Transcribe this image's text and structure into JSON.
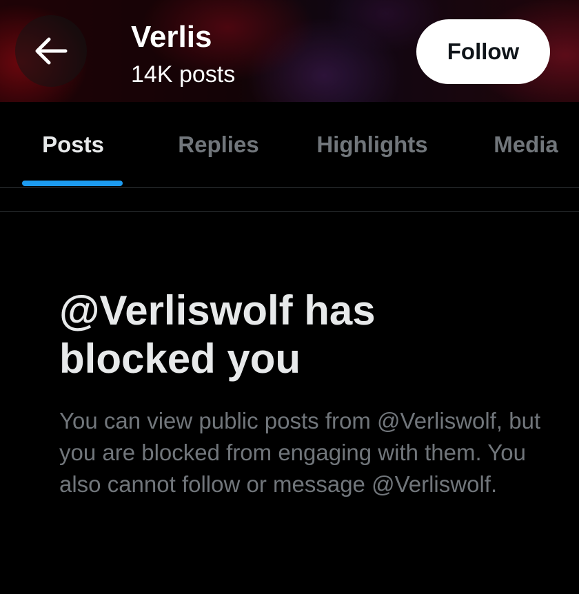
{
  "header": {
    "back_icon": "arrow-left-icon",
    "name": "Verlis",
    "post_count": "14K posts",
    "follow_label": "Follow",
    "banner_colors": [
      "#2a0408",
      "#a00a14",
      "#5a2878"
    ]
  },
  "tabs": [
    {
      "label": "Posts",
      "active": true
    },
    {
      "label": "Replies",
      "active": false
    },
    {
      "label": "Highlights",
      "active": false
    },
    {
      "label": "Media",
      "active": false
    }
  ],
  "blocked_notice": {
    "title": "@Verliswolf has blocked you",
    "description": "You can view public posts from @Verliswolf, but you are blocked from engaging with them. You also cannot follow or message @Verliswolf."
  },
  "colors": {
    "background": "#000000",
    "accent": "#1d9bf0",
    "primary_text": "#e7e9ea",
    "secondary_text": "#71767b",
    "border": "#2f3336"
  }
}
